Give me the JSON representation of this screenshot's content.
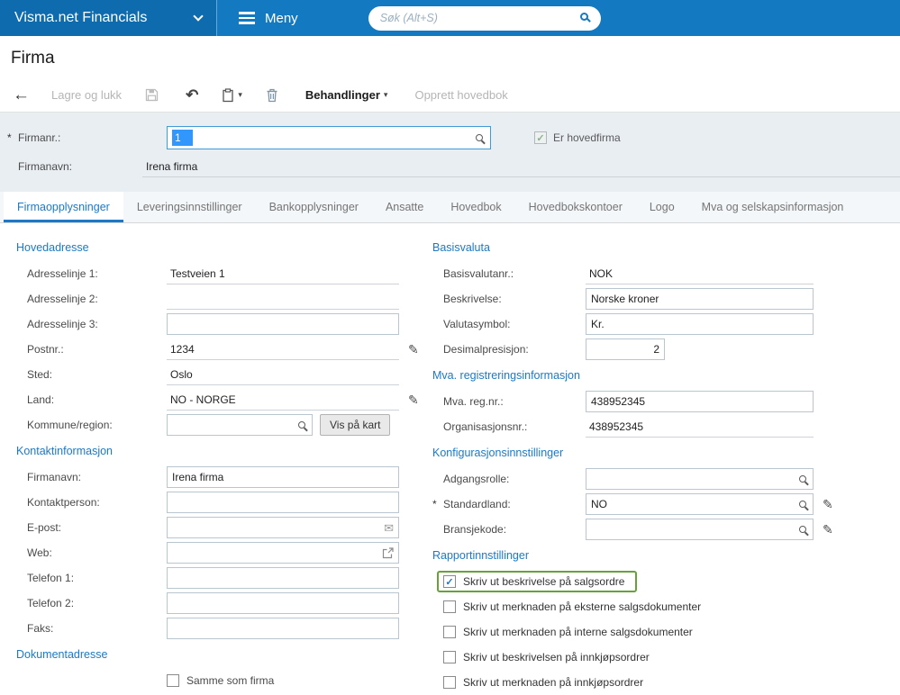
{
  "colors": {
    "accent_blue": "#1a7ac9",
    "topbar_blue": "#1379c0",
    "highlight_green": "#68a03a",
    "selection_blue": "#3297fd",
    "panel_bg": "#e9eef3"
  },
  "icons": {
    "back": "←",
    "undo": "↶",
    "caret_down": "▾",
    "pencil": "✎",
    "envelope": "✉",
    "check": "✓"
  },
  "misc": {
    "required_marker": "*"
  },
  "topbar": {
    "app_title": "Visma.net Financials",
    "menu_label": "Meny",
    "search_placeholder": "Søk (Alt+S)"
  },
  "page_title": "Firma",
  "toolbar": {
    "save_close": "Lagre og lukk",
    "actions": "Behandlinger",
    "create_ledger": "Opprett hovedbok"
  },
  "header_form": {
    "company_no_label": "Firmanr.:",
    "company_no_value": "1",
    "company_name_label": "Firmanavn:",
    "company_name_value": "Irena firma",
    "main_company_label": "Er hovedfirma",
    "main_company_checked": true
  },
  "tabs": [
    {
      "label": "Firmaopplysninger",
      "active": true
    },
    {
      "label": "Leveringsinnstillinger",
      "active": false
    },
    {
      "label": "Bankopplysninger",
      "active": false
    },
    {
      "label": "Ansatte",
      "active": false
    },
    {
      "label": "Hovedbok",
      "active": false
    },
    {
      "label": "Hovedbokskontoer",
      "active": false
    },
    {
      "label": "Logo",
      "active": false
    },
    {
      "label": "Mva og selskapsinformasjon",
      "active": false
    }
  ],
  "left": {
    "hovedadresse": {
      "title": "Hovedadresse",
      "address1_label": "Adresselinje 1:",
      "address1_value": "Testveien 1",
      "address2_label": "Adresselinje 2:",
      "address2_value": "",
      "address3_label": "Adresselinje 3:",
      "address3_value": "",
      "postal_label": "Postnr.:",
      "postal_value": "1234",
      "city_label": "Sted:",
      "city_value": "Oslo",
      "country_label": "Land:",
      "country_value": "NO - NORGE",
      "municipality_label": "Kommune/region:",
      "municipality_value": "",
      "map_button": "Vis på kart"
    },
    "kontakt": {
      "title": "Kontaktinformasjon",
      "company_label": "Firmanavn:",
      "company_value": "Irena firma",
      "contact_label": "Kontaktperson:",
      "contact_value": "",
      "email_label": "E-post:",
      "email_value": "",
      "web_label": "Web:",
      "web_value": "",
      "phone1_label": "Telefon 1:",
      "phone1_value": "",
      "phone2_label": "Telefon 2:",
      "phone2_value": "",
      "fax_label": "Faks:",
      "fax_value": ""
    },
    "dokument": {
      "title": "Dokumentadresse",
      "same_as_company_label": "Samme som firma",
      "same_as_company_checked": false
    }
  },
  "right": {
    "basisvaluta": {
      "title": "Basisvaluta",
      "currency_id_label": "Basisvalutanr.:",
      "currency_id_value": "NOK",
      "description_label": "Beskrivelse:",
      "description_value": "Norske kroner",
      "symbol_label": "Valutasymbol:",
      "symbol_value": "Kr.",
      "decimal_label": "Desimalpresisjon:",
      "decimal_value": "2"
    },
    "mva": {
      "title": "Mva. registreringsinformasjon",
      "vat_reg_label": "Mva. reg.nr.:",
      "vat_reg_value": "438952345",
      "org_no_label": "Organisasjonsnr.:",
      "org_no_value": "438952345"
    },
    "konfig": {
      "title": "Konfigurasjonsinnstillinger",
      "access_role_label": "Adgangsrolle:",
      "access_role_value": "",
      "default_country_label": "Standardland:",
      "default_country_value": "NO",
      "industry_code_label": "Bransjekode:",
      "industry_code_value": ""
    },
    "rapport": {
      "title": "Rapportinnstillinger",
      "checkboxes": [
        {
          "label": "Skriv ut beskrivelse på salgsordre",
          "checked": true,
          "highlighted": true
        },
        {
          "label": "Skriv ut merknaden på eksterne salgsdokumenter",
          "checked": false
        },
        {
          "label": "Skriv ut merknaden på interne salgsdokumenter",
          "checked": false
        },
        {
          "label": "Skriv ut beskrivelsen på innkjøpsordrer",
          "checked": false
        },
        {
          "label": "Skriv ut merknaden på innkjøpsordrer",
          "checked": false
        }
      ]
    }
  }
}
